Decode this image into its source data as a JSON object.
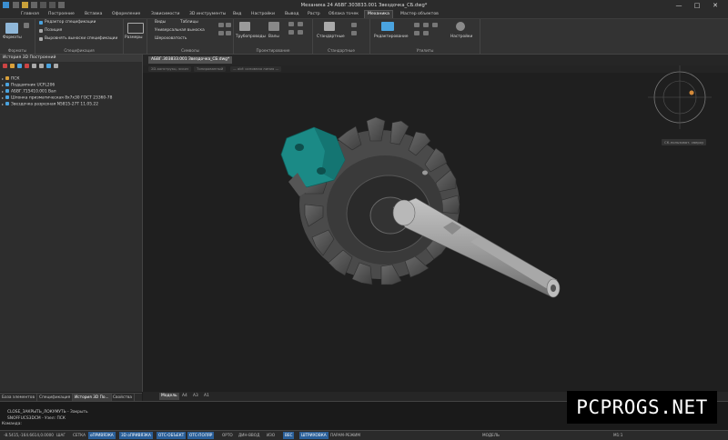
{
  "window": {
    "title": "Механика 24 АБВГ.303833.001 Звездочка_СБ.dwg*",
    "controls": [
      "—",
      "□",
      "✕"
    ]
  },
  "tabs": [
    "Главная",
    "Построение",
    "Вставка",
    "Оформление",
    "Зависимости",
    "3D инструменты",
    "Вид",
    "Настройки",
    "Вывод",
    "Растр",
    "Облака точек",
    "Механика",
    "Мастер объектов"
  ],
  "active_tab": "Механика",
  "ribbon": {
    "groups": [
      {
        "label": "Форматы",
        "items": [
          "Форматы"
        ]
      },
      {
        "label": "Спецификация",
        "items": [
          "Редактор спецификации",
          "Позиция",
          "Выровнять выноски спецификации"
        ]
      },
      {
        "label": "",
        "items": [
          "Размеры"
        ]
      },
      {
        "label": "Символы",
        "items": [
          "Виды",
          "Таблицы",
          "Универсальная выноска",
          "Шероховатость"
        ]
      },
      {
        "label": "Проектирование",
        "items": [
          "Трубопроводы",
          "Валы"
        ]
      },
      {
        "label": "Стандартные",
        "items": [
          "Стандартные"
        ]
      },
      {
        "label": "Утилиты",
        "items": [
          "Редактирование",
          "Настройки"
        ]
      }
    ]
  },
  "left_panel": {
    "title": "История 3D Построений",
    "tree": [
      {
        "label": "ПСК",
        "color": "#d9a03a"
      },
      {
        "label": "Подшипник UCFL206",
        "color": "#4aa3df"
      },
      {
        "label": "АБВГ.715410.001 Вал",
        "color": "#4aa3df"
      },
      {
        "label": "Шпонка призматическая 8х7х30 ГОСТ 23360-78",
        "color": "#4aa3df"
      },
      {
        "label": "Звездочка разрезная N5815-27Т 11.05.22",
        "color": "#4aa3df"
      }
    ],
    "bottom_tabs": [
      "База элементов",
      "Спецификация",
      "История 3D По...",
      "Свойства"
    ],
    "active_bottom_tab": "История 3D По..."
  },
  "document_tabs": [
    "АБВГ.303833.001 Звездочка_СБ.dwg*"
  ],
  "sub_tabs": [
    "2D-конструкц. эскиз",
    "Тонированный",
    "— abf: основная линия —"
  ],
  "viewcube_label": "СК-пользоват. сверху",
  "layout_tabs": [
    "Модель",
    "А4",
    "А3",
    "А1"
  ],
  "active_layout": "Модель",
  "command_lines": [
    "CLOSE_ЗАКРЫТЬ_ЛОКУМУТЬ - Закрыть",
    "SNOFFUCS3DCM - Узел: ПСК"
  ],
  "command_prompt": "Команда:",
  "status_bar": {
    "coords": "-8.5415,-164.6614,0.0000",
    "toggles": [
      {
        "label": "ШАГ",
        "on": false
      },
      {
        "label": "СЕТКА",
        "on": false
      },
      {
        "label": "оПРИВЯЗКА",
        "on": true
      },
      {
        "label": "3D оПРИВЯЗКА",
        "on": true
      },
      {
        "label": "ОТС-ОБЪЕКТ",
        "on": true
      },
      {
        "label": "ОТС-ПОЛЯР",
        "on": true
      },
      {
        "label": "ОРТО",
        "on": false
      },
      {
        "label": "ДИН-ВВОД",
        "on": false
      },
      {
        "label": "ИЗО",
        "on": false
      },
      {
        "label": "ВЕС",
        "on": true
      },
      {
        "label": "ШТРИХОВКА",
        "on": true
      },
      {
        "label": "ПАРАМ-РЕЖИМ",
        "on": false
      }
    ],
    "model_label": "МОДЕЛЬ",
    "scale": "М1:1"
  },
  "watermark": "PCPROGS.NET",
  "colors": {
    "gear": "#5a5a5a",
    "shaft": "#9a9a9a",
    "bearing": "#1b8a86",
    "accent_on": "#2a5f99"
  }
}
